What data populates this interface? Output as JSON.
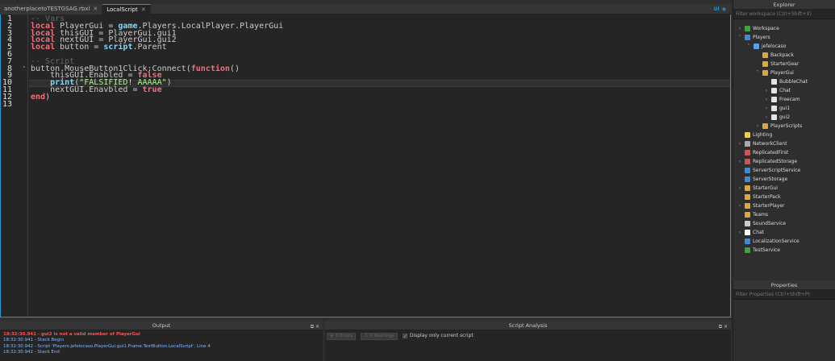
{
  "tabs": [
    {
      "label": "anotherplacetoTESTGSAG.rbxl",
      "active": false
    },
    {
      "label": "LocalScript",
      "active": true
    }
  ],
  "tab_tools": {
    "ui_label": "UI"
  },
  "editor": {
    "line_numbers": [
      "1",
      "2",
      "3",
      "4",
      "5",
      "6",
      "7",
      "8",
      "9",
      "10",
      "11",
      "12",
      "13"
    ],
    "current_line": 10,
    "lines": [
      {
        "t": "-- Vars"
      },
      {
        "t": "local PlayerGui = game.Players.LocalPlayer.PlayerGui"
      },
      {
        "t": "local thisGUI = PlayerGui.gui1"
      },
      {
        "t": "local nextGUI = PlayerGui.gui2"
      },
      {
        "t": "local button = script.Parent"
      },
      {
        "t": ""
      },
      {
        "t": "-- Script"
      },
      {
        "t": "button.MouseButton1Click:Connect(function()"
      },
      {
        "t": "    thisGUI.Enabled = false"
      },
      {
        "t": "    print(\"FALSIFIED! AAAAA\")"
      },
      {
        "t": "    nextGUI.Enavbled = true"
      },
      {
        "t": "end)"
      },
      {
        "t": ""
      }
    ]
  },
  "explorer": {
    "title": "Explorer",
    "filter_placeholder": "Filter workspace (Ctrl+Shift+X)",
    "items": [
      {
        "label": "Workspace",
        "arrow": "›",
        "icon": "globe-icon",
        "color": "#3aa63a",
        "depth": 0
      },
      {
        "label": "Players",
        "arrow": "˅",
        "icon": "players-icon",
        "color": "#3c8ad8",
        "depth": 0
      },
      {
        "label": "jefelocaso",
        "arrow": "˅",
        "icon": "player-icon",
        "color": "#5aa0e6",
        "depth": 1
      },
      {
        "label": "Backpack",
        "arrow": "",
        "icon": "backpack-icon",
        "color": "#d8a93c",
        "depth": 2
      },
      {
        "label": "StarterGear",
        "arrow": "",
        "icon": "startergear-icon",
        "color": "#d8a93c",
        "depth": 2
      },
      {
        "label": "PlayerGui",
        "arrow": "˅",
        "icon": "playergui-icon",
        "color": "#d8a93c",
        "depth": 2
      },
      {
        "label": "BubbleChat",
        "arrow": "",
        "icon": "screengui-icon",
        "color": "#e4e4e4",
        "depth": 3
      },
      {
        "label": "Chat",
        "arrow": "›",
        "icon": "screengui-icon",
        "color": "#e4e4e4",
        "depth": 3
      },
      {
        "label": "Freecam",
        "arrow": "›",
        "icon": "screengui-icon",
        "color": "#e4e4e4",
        "depth": 3
      },
      {
        "label": "gui1",
        "arrow": "›",
        "icon": "screengui-icon",
        "color": "#e4e4e4",
        "depth": 3
      },
      {
        "label": "gui2",
        "arrow": "›",
        "icon": "screengui-icon",
        "color": "#e4e4e4",
        "depth": 3
      },
      {
        "label": "PlayerScripts",
        "arrow": "›",
        "icon": "playerscripts-icon",
        "color": "#d8a93c",
        "depth": 2
      },
      {
        "label": "Lighting",
        "arrow": "",
        "icon": "lightbulb-icon",
        "color": "#f0d040",
        "depth": 0
      },
      {
        "label": "NetworkClient",
        "arrow": "›",
        "icon": "network-icon",
        "color": "#aaaaaa",
        "depth": 0
      },
      {
        "label": "ReplicatedFirst",
        "arrow": "",
        "icon": "replicatedfirst-icon",
        "color": "#d85050",
        "depth": 0
      },
      {
        "label": "ReplicatedStorage",
        "arrow": "›",
        "icon": "replicatedstorage-icon",
        "color": "#d85050",
        "depth": 0
      },
      {
        "label": "ServerScriptService",
        "arrow": "",
        "icon": "serverscriptservice-icon",
        "color": "#3c8ad8",
        "depth": 0
      },
      {
        "label": "ServerStorage",
        "arrow": "",
        "icon": "serverstorage-icon",
        "color": "#3c8ad8",
        "depth": 0
      },
      {
        "label": "StarterGui",
        "arrow": "›",
        "icon": "startergui-icon",
        "color": "#d8a93c",
        "depth": 0
      },
      {
        "label": "StarterPack",
        "arrow": "",
        "icon": "starterpack-icon",
        "color": "#d8a93c",
        "depth": 0
      },
      {
        "label": "StarterPlayer",
        "arrow": "›",
        "icon": "starterplayer-icon",
        "color": "#d8a93c",
        "depth": 0
      },
      {
        "label": "Teams",
        "arrow": "",
        "icon": "teams-icon",
        "color": "#d8a93c",
        "depth": 0
      },
      {
        "label": "SoundService",
        "arrow": "",
        "icon": "sound-icon",
        "color": "#cccccc",
        "depth": 0
      },
      {
        "label": "Chat",
        "arrow": "›",
        "icon": "chat-icon",
        "color": "#ffffff",
        "depth": 0
      },
      {
        "label": "LocalizationService",
        "arrow": "",
        "icon": "localization-icon",
        "color": "#3c8ad8",
        "depth": 0
      },
      {
        "label": "TestService",
        "arrow": "",
        "icon": "testservice-icon",
        "color": "#3aa63a",
        "depth": 0
      }
    ]
  },
  "properties": {
    "title": "Properties",
    "filter_placeholder": "Filter Properties (Ctrl+Shift+P)"
  },
  "output": {
    "title": "Output",
    "lines": [
      {
        "text": "18:32:30.941 - gui2 is not a valid member of PlayerGui",
        "kind": "error"
      },
      {
        "text": "18:32:30.941 - Stack Begin",
        "kind": "info"
      },
      {
        "text": "18:32:30.942 - Script 'Players.jefelocaso.PlayerGui.gui1.Frame.TextButton.LocalScript', Line 4",
        "kind": "info"
      },
      {
        "text": "18:32:30.942 - Stack End",
        "kind": "info"
      }
    ]
  },
  "analysis": {
    "title": "Script Analysis",
    "errors_label": "0 Errors",
    "warnings_label": "0 Warnings",
    "checkbox_label": "Display only current script",
    "checkbox_checked": true
  }
}
